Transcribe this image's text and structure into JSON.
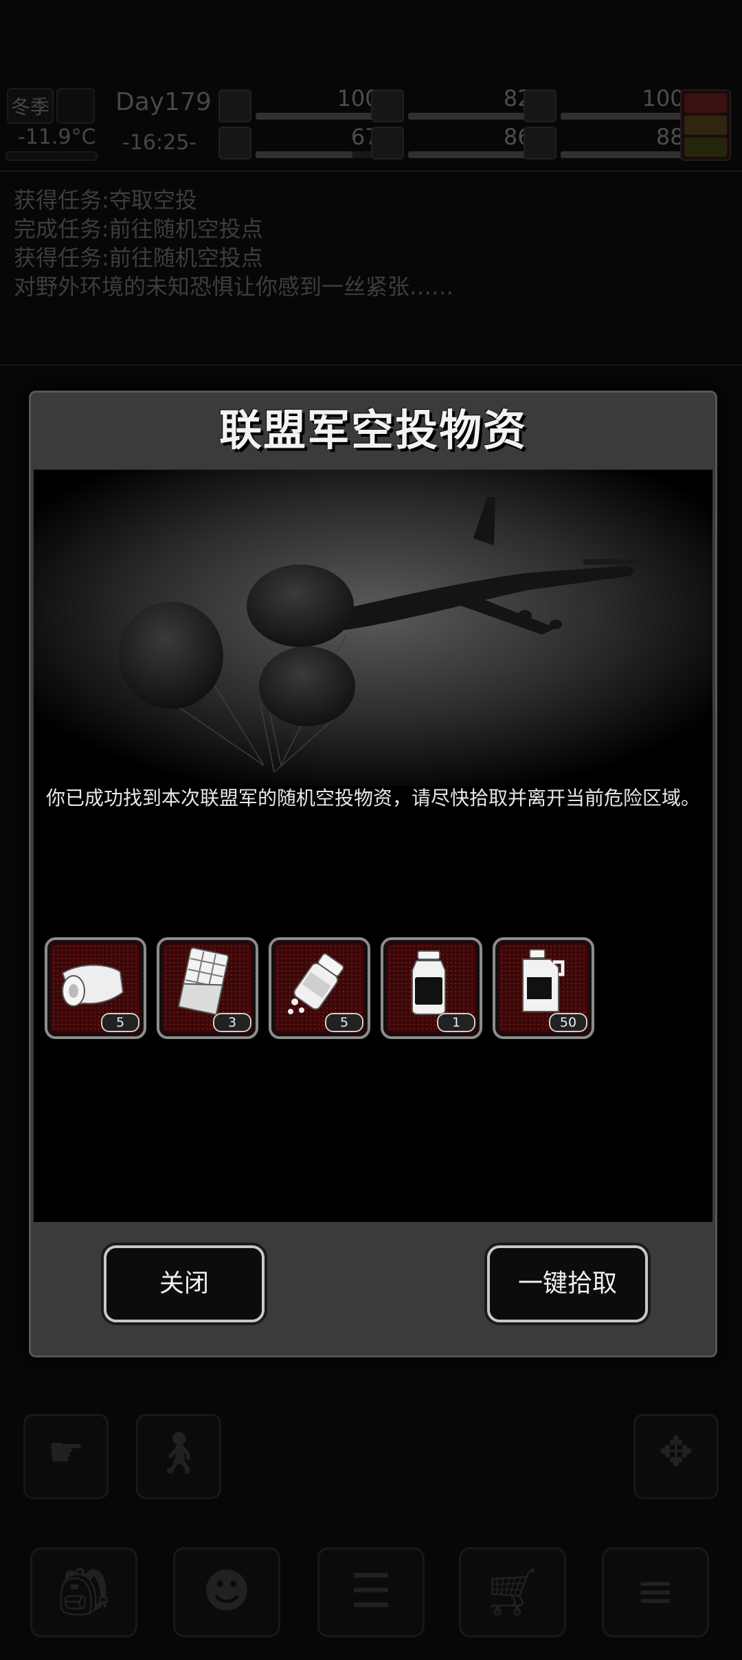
{
  "hud": {
    "season": "冬季",
    "temperature": "-11.9°C",
    "day": "Day179",
    "time": "-16:25-",
    "stats": [
      {
        "icon": "medkit-icon",
        "value": "100%",
        "level": 1.0
      },
      {
        "icon": "stomach-icon",
        "value": "82%",
        "level": 0.82
      },
      {
        "icon": "energy-icon",
        "value": "100%",
        "level": 1.0
      },
      {
        "icon": "flask-icon",
        "value": "67%",
        "level": 0.67
      },
      {
        "icon": "water-drop-icon",
        "value": "86%",
        "level": 0.86
      },
      {
        "icon": "heart-icon",
        "value": "88%",
        "level": 0.88
      }
    ]
  },
  "log": [
    "获得任务:夺取空投",
    "完成任务:前往随机空投点",
    "获得任务:前往随机空投点",
    "对野外环境的未知恐惧让你感到一丝紧张……"
  ],
  "dialog": {
    "title": "联盟军空投物资",
    "description": "你已成功找到本次联盟军的随机空投物资，请尽快拾取并离开当前危险区域。",
    "items": [
      {
        "icon": "bandage-icon",
        "count": "5"
      },
      {
        "icon": "chocolate-bar-icon",
        "count": "3"
      },
      {
        "icon": "pill-bottle-icon",
        "count": "5"
      },
      {
        "icon": "jar-icon",
        "count": "1"
      },
      {
        "icon": "fuel-canister-icon",
        "count": "50"
      }
    ],
    "close_label": "关闭",
    "pickup_all_label": "一键拾取"
  },
  "colors": {
    "accent_item_bg": "#3a0808",
    "button_border": "#c8c8c8",
    "dialog_bg": "#3b3b3b"
  }
}
